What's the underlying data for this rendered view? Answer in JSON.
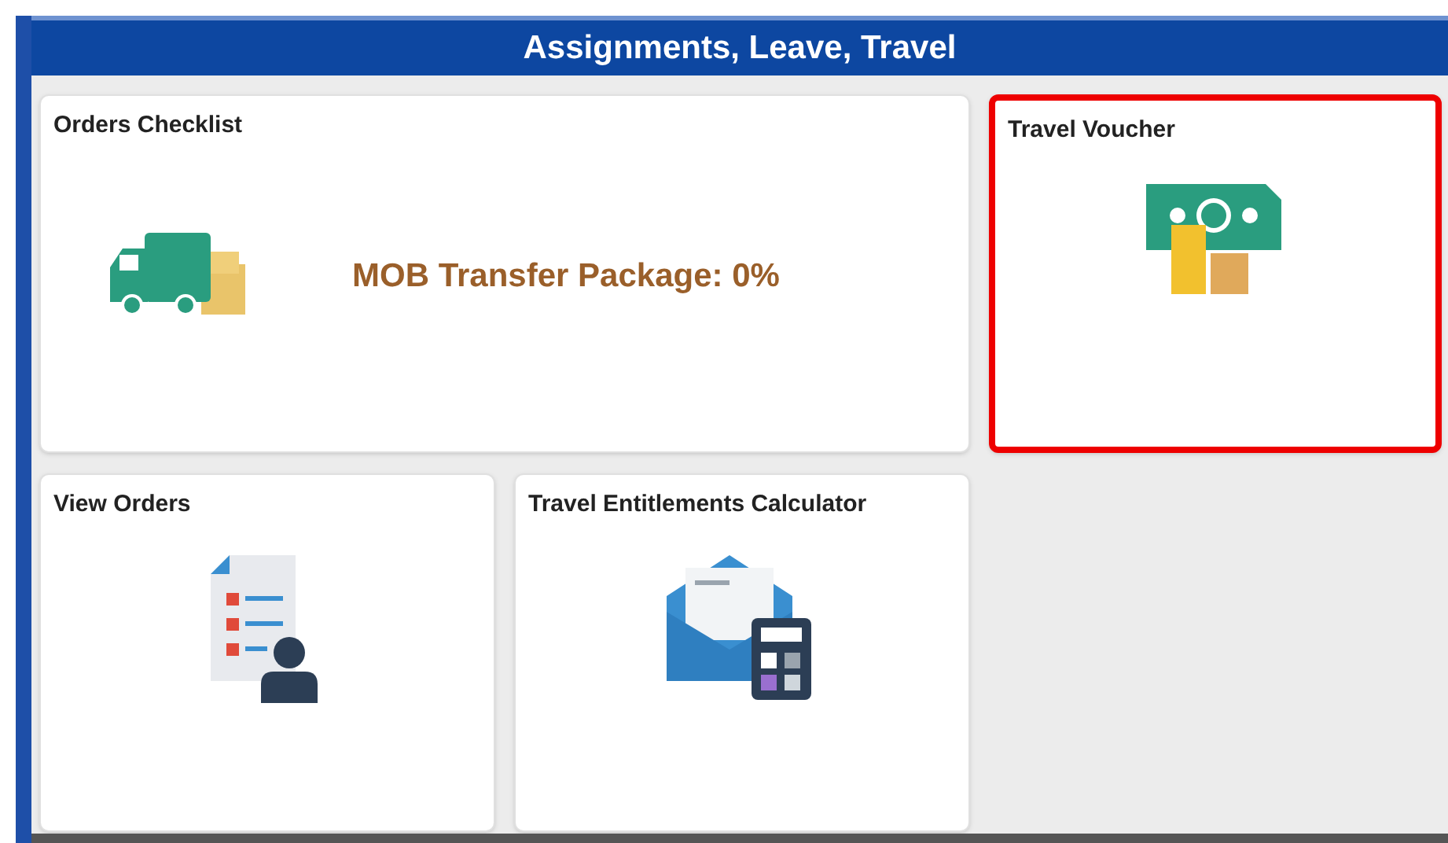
{
  "header": {
    "title": "Assignments, Leave, Travel"
  },
  "tiles": [
    {
      "title": "Orders Checklist",
      "kind": "truck",
      "status": "MOB Transfer Package: 0%",
      "wide": true,
      "highlighted": false
    },
    {
      "title": "Travel Voucher",
      "kind": "money",
      "wide": false,
      "highlighted": true
    },
    {
      "title": "View Orders",
      "kind": "document",
      "wide": false,
      "highlighted": false
    },
    {
      "title": "Travel Entitlements Calculator",
      "kind": "calculator",
      "wide": false,
      "highlighted": false
    }
  ]
}
